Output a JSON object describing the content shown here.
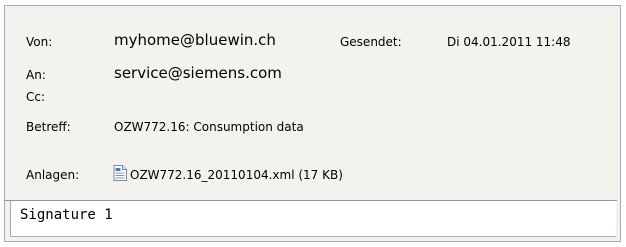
{
  "header": {
    "from_label": "Von:",
    "from_value": "myhome@bluewin.ch",
    "sent_label": "Gesendet:",
    "sent_value": "Di 04.01.2011 11:48",
    "to_label": "An:",
    "to_value": "service@siemens.com",
    "cc_label": "Cc:",
    "subject_label": "Betreff:",
    "subject_value": "OZW772.16: Consumption data",
    "attachments_label": "Anlagen:",
    "attachment_name": "OZW772.16_20110104.xml (17 KB)",
    "attachment_icon": "xml-file-icon"
  },
  "body": {
    "text": "Signature 1"
  },
  "colors": {
    "header_bg": "#f3f2ee",
    "border": "#a5acb5",
    "body_bg": "#ffffff"
  }
}
